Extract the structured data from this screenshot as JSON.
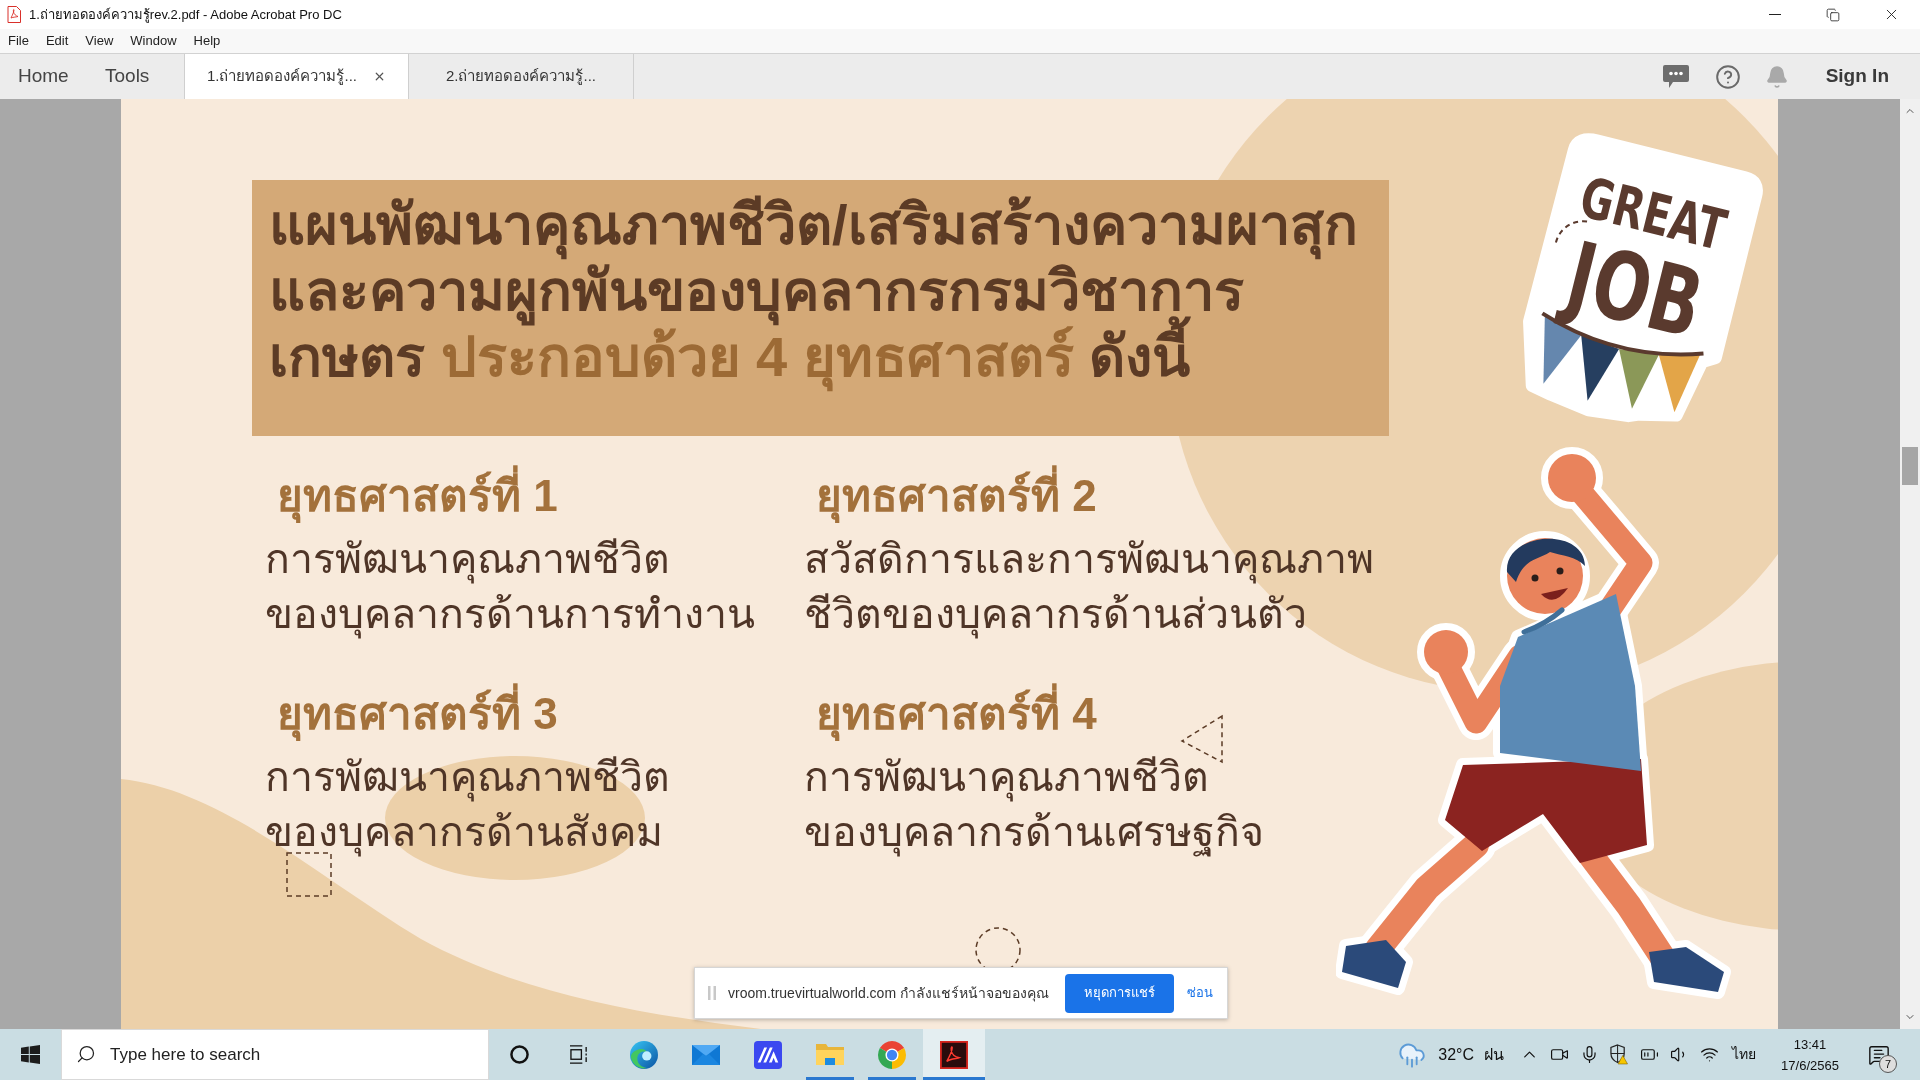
{
  "window": {
    "title": "1.ถ่ายทอดองค์ความรู้rev.2.pdf - Adobe Acrobat Pro DC"
  },
  "menu": [
    "File",
    "Edit",
    "View",
    "Window",
    "Help"
  ],
  "tabs": [
    {
      "kind": "nav",
      "label": "Home",
      "selected": false
    },
    {
      "kind": "nav",
      "label": "Tools",
      "selected": false
    },
    {
      "kind": "document",
      "label": "1.ถ่ายทอดองค์ความรู้...",
      "selected": true
    },
    {
      "kind": "document",
      "label": "2.ถ่ายทอดองค์ความรู้...",
      "selected": false
    }
  ],
  "account": {
    "sign_in": "Sign In"
  },
  "page": {
    "heading": [
      [
        {
          "text": "แผนพัฒนาคุณภาพชีวิต/เสริมสร้างความผาสุก",
          "highlight": false
        }
      ],
      [
        {
          "text": "และความผูกพันของบุคลากรกรมวิชาการ",
          "highlight": false
        }
      ],
      [
        {
          "text": "เกษตร ",
          "highlight": false
        },
        {
          "text": "ประกอบด้วย 4 ยุทธศาสตร์",
          "highlight": true
        },
        {
          "text": " ดังนี้",
          "highlight": false
        }
      ]
    ],
    "strategies": [
      {
        "heading": "ยุทธศาสตร์ที่ 1",
        "lines": [
          "การพัฒนาคุณภาพชีวิต",
          "ของบุคลากรด้านการทำงาน"
        ]
      },
      {
        "heading": "ยุทธศาสตร์ที่ 2",
        "lines": [
          "สวัสดิการและการพัฒนาคุณภาพ",
          "ชีวิตของบุคลากรด้านส่วนตัว"
        ]
      },
      {
        "heading": "ยุทธศาสตร์ที่ 3",
        "lines": [
          "การพัฒนาคุณภาพชีวิต",
          "ของบุคลากรด้านสังคม"
        ]
      },
      {
        "heading": "ยุทธศาสตร์ที่ 4",
        "lines": [
          "การพัฒนาคุณภาพชีวิต",
          "ของบุคลากรด้านเศรษฐกิจ"
        ]
      }
    ],
    "sticker": [
      "GREAT",
      "JOB"
    ]
  },
  "share_notice": {
    "message": "vroom.truevirtualworld.com กำลังแชร์หน้าจอของคุณ",
    "stop_button": "หยุดการแชร์",
    "hide_link": "ซ่อน"
  },
  "taskbar": {
    "search": {
      "placeholder": "Type here to search"
    },
    "apps": [
      {
        "running": false,
        "active": false
      },
      {
        "running": false,
        "active": false
      },
      {
        "running": false,
        "active": false
      },
      {
        "running": true,
        "active": false
      },
      {
        "running": true,
        "active": false
      },
      {
        "running": true,
        "active": true
      }
    ],
    "weather": {
      "temperature": "32°C",
      "condition": "ฝน"
    },
    "language": "ไทย",
    "time": "13:41",
    "date": "17/6/2565",
    "notifications": "7"
  }
}
